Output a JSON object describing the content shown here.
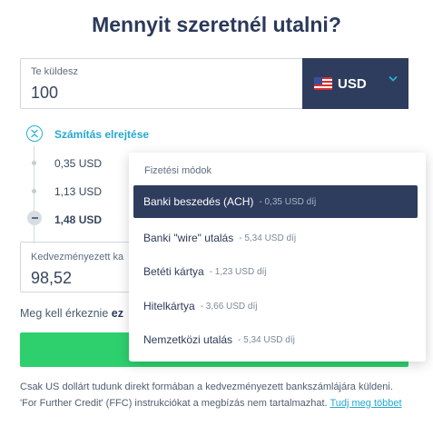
{
  "title": "Mennyit szeretnél utalni?",
  "send": {
    "label": "Te küldesz",
    "amount": "100",
    "currency": "USD",
    "currency_icon": "us-flag-icon"
  },
  "fees": {
    "toggle_label": "Számítás elrejtése",
    "rows": [
      "0,35 USD",
      "1,13 USD",
      "1,48 USD"
    ]
  },
  "receive": {
    "label": "Kedvezményezett ka",
    "amount": "98,52"
  },
  "arrival": {
    "prefix": "Meg kell érkeznie",
    "bold": "ez"
  },
  "note": {
    "text": "Csak US dollárt tudunk direkt formában a kedvezményezett bankszámlájára küldeni. 'For Further Credit' (FFC) instrukciókat a megbízás nem tartalmazhat.",
    "link": "Tudj meg többet"
  },
  "dropdown": {
    "header": "Fizetési módok",
    "items": [
      {
        "label": "Banki beszedés (ACH)",
        "fee": "- 0,35 USD díj",
        "selected": true
      },
      {
        "label": "Banki \"wire\" utalás",
        "fee": "- 5,34 USD díj",
        "selected": false
      },
      {
        "label": "Betéti kártya",
        "fee": "- 1,23 USD díj",
        "selected": false
      },
      {
        "label": "Hitelkártya",
        "fee": "- 3,66 USD díj",
        "selected": false
      },
      {
        "label": "Nemzetközi utalás",
        "fee": "- 5,34 USD díj",
        "selected": false
      }
    ]
  },
  "colors": {
    "navy": "#2e3c5e",
    "accent_blue": "#24a8d0",
    "cta_green": "#2ed06e"
  }
}
